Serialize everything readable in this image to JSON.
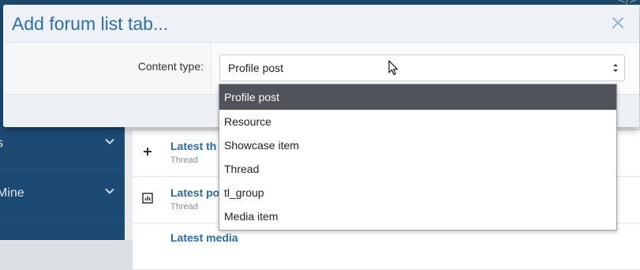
{
  "background": {
    "topbar_glyph": "</>",
    "sidebar": {
      "items": [
        {
          "label": "s"
        },
        {
          "label": "Mine"
        }
      ]
    },
    "rows": [
      {
        "icon": "plus-icon",
        "title": "Latest th",
        "subtitle": "Thread"
      },
      {
        "icon": "chart-icon",
        "title": "Latest po",
        "subtitle": "Thread"
      },
      {
        "icon": "",
        "title": "Latest media",
        "subtitle": ""
      }
    ]
  },
  "modal": {
    "title": "Add forum list tab...",
    "close_glyph": "×",
    "content_type": {
      "label": "Content type:",
      "value": "Profile post",
      "options": [
        "Profile post",
        "Resource",
        "Showcase item",
        "Thread",
        "tl_group",
        "Media item"
      ],
      "selected_index": 0
    }
  },
  "colors": {
    "title": "#2f6fa8",
    "sidebar": "#1d4a73",
    "selected_option_bg": "#505359"
  }
}
